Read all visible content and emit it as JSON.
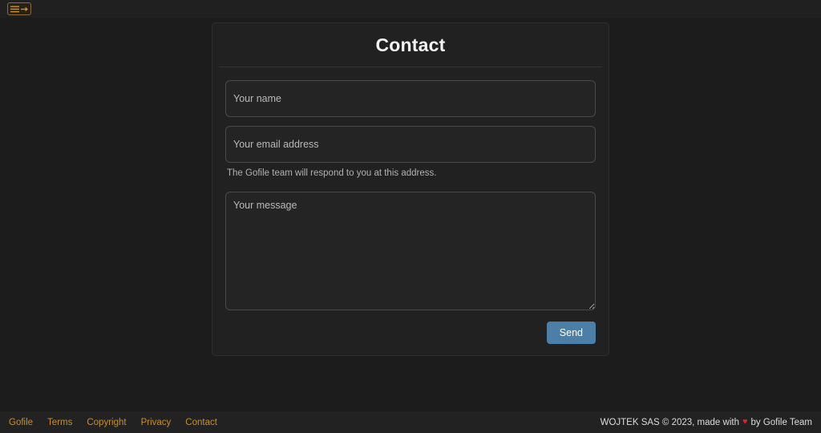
{
  "topbar": {
    "menu_toggle_name": "menu-toggle-icon",
    "menu_toggle_title": "Toggle menu"
  },
  "card": {
    "title": "Contact",
    "fields": {
      "name": {
        "placeholder": "Your name",
        "value": ""
      },
      "email": {
        "placeholder": "Your email address",
        "value": "",
        "help": "The Gofile team will respond to you at this address."
      },
      "message": {
        "placeholder": "Your message",
        "value": ""
      }
    },
    "submit_label": "Send"
  },
  "footer": {
    "links": [
      {
        "label": "Gofile"
      },
      {
        "label": "Terms"
      },
      {
        "label": "Copyright"
      },
      {
        "label": "Privacy"
      },
      {
        "label": "Contact"
      }
    ],
    "credit_prefix": "WOJTEK SAS © 2023, made with",
    "credit_heart": "♥",
    "credit_suffix": "by Gofile Team"
  },
  "colors": {
    "page_bg": "#1c1c1c",
    "card_bg": "#212121",
    "accent_link": "#c98f2e",
    "submit_bg": "#4c7fa8",
    "heart": "#e0242c",
    "menu_border": "#8a6a3e"
  }
}
